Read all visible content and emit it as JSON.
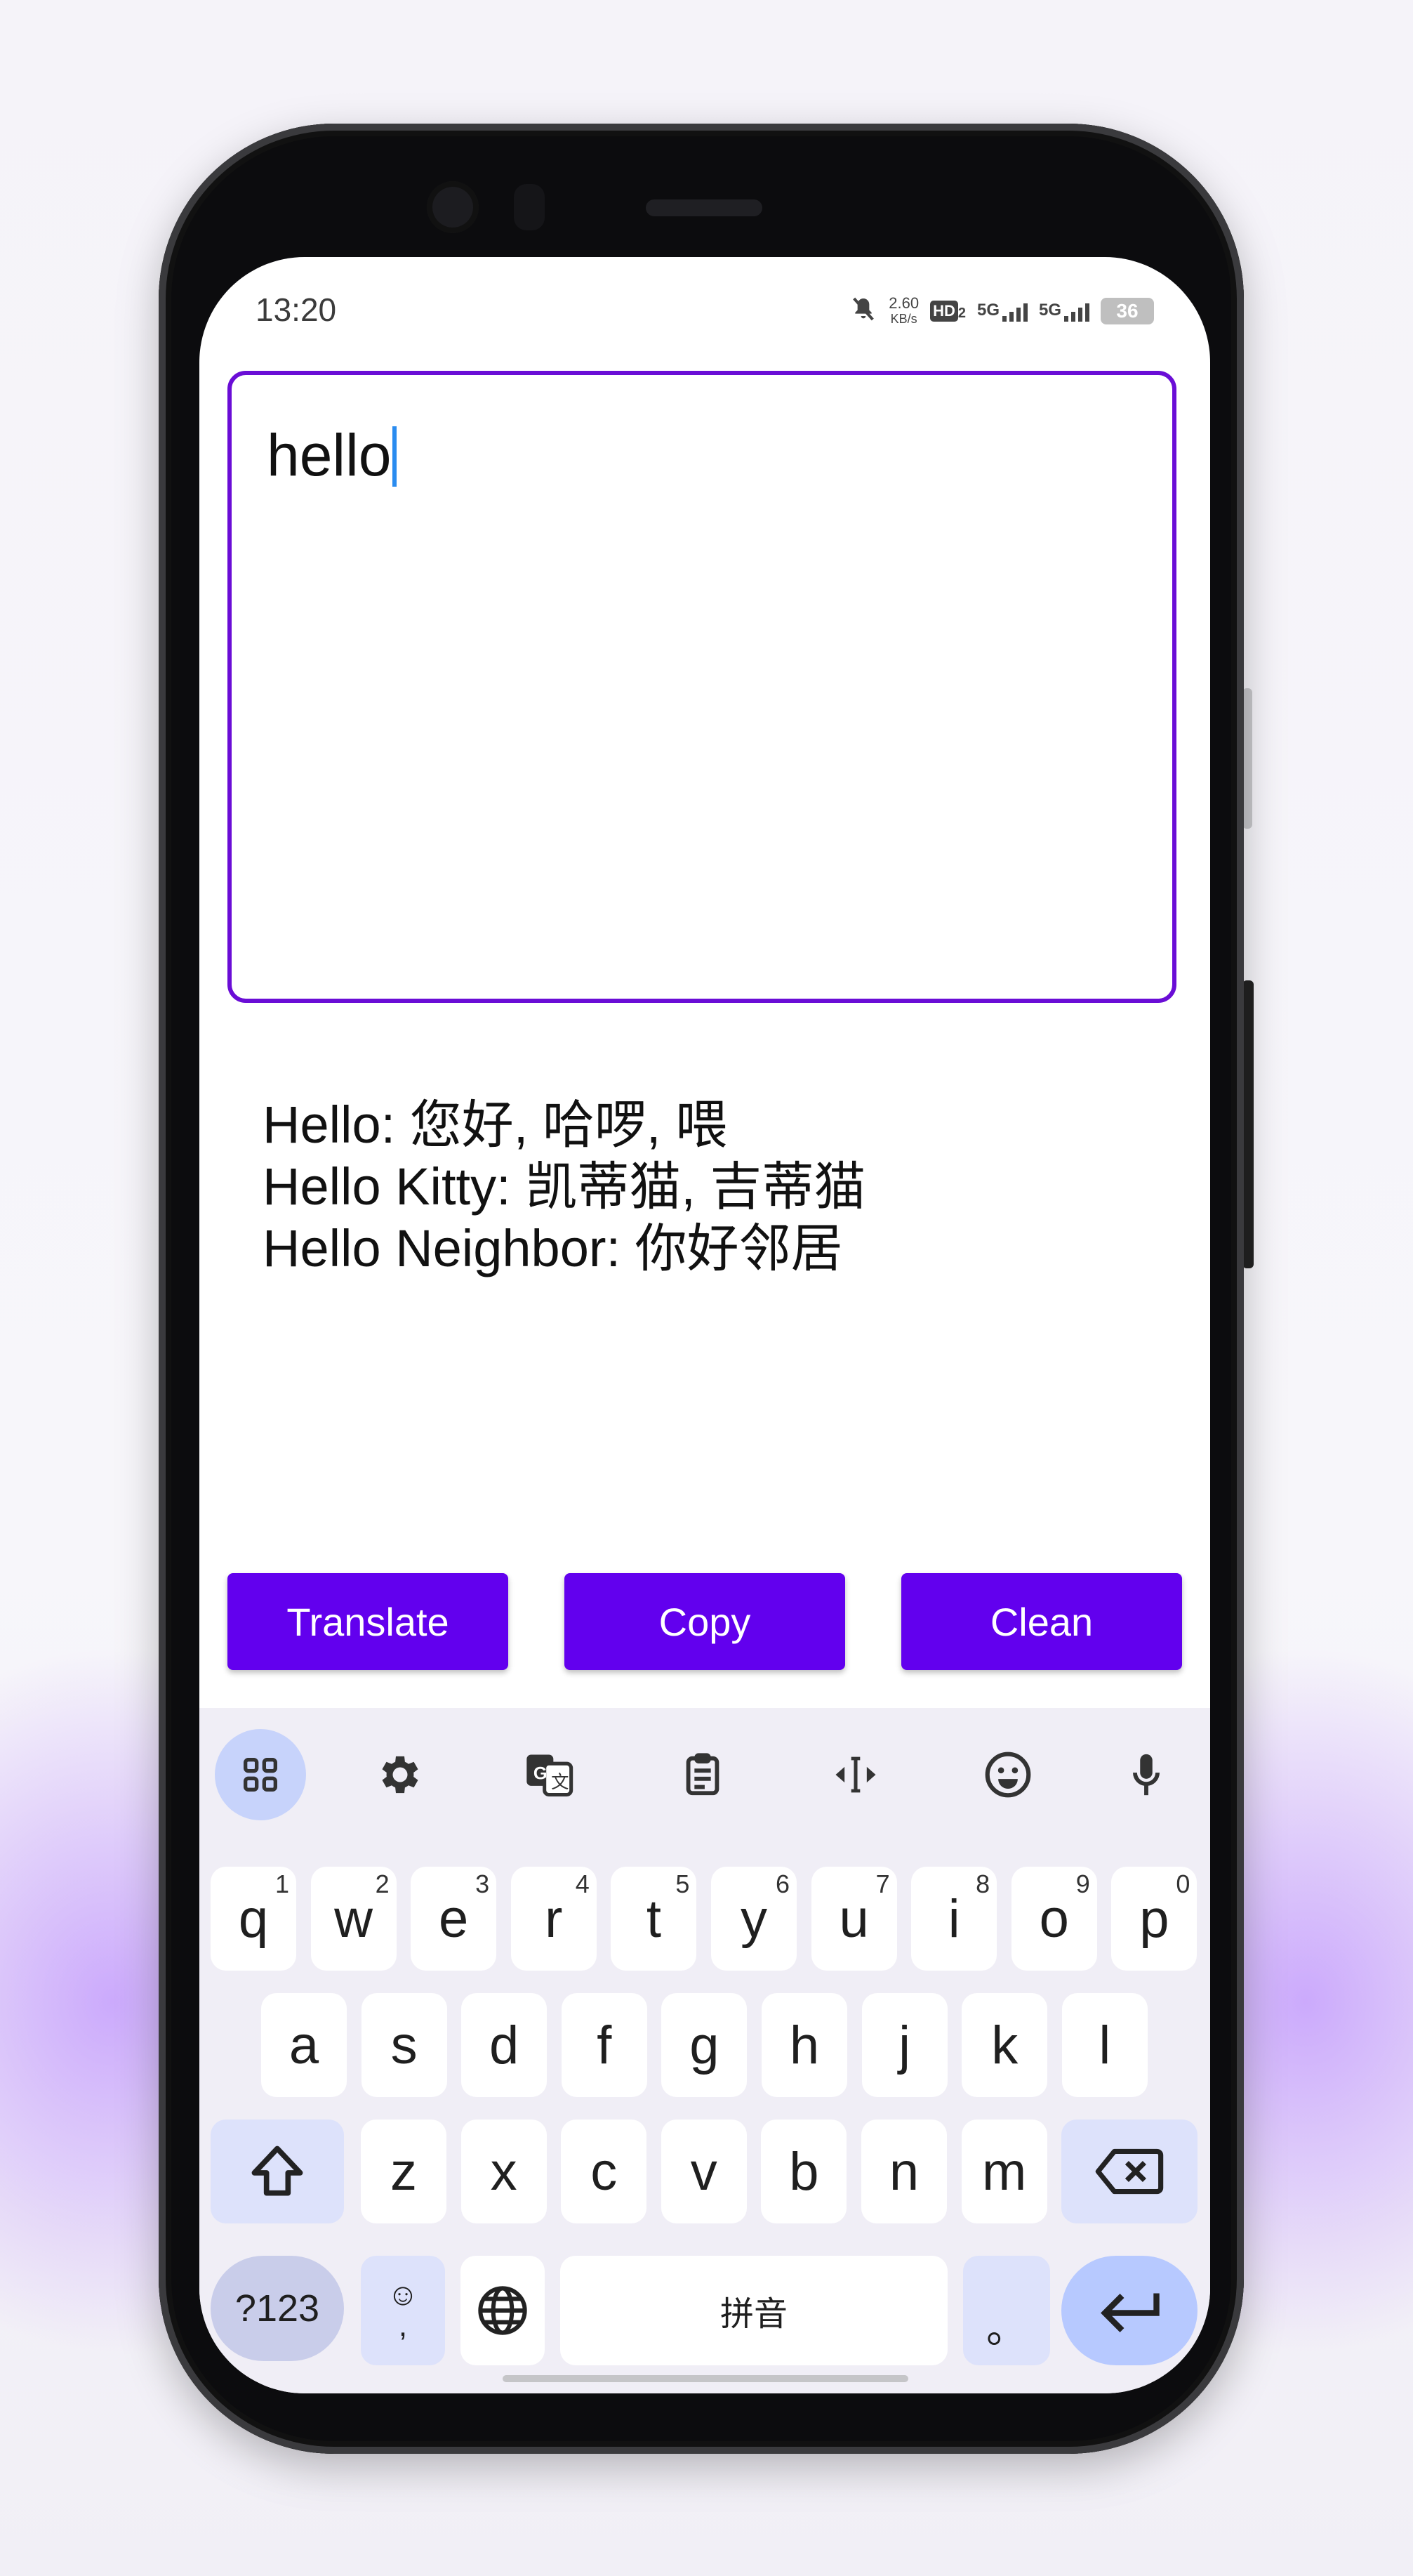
{
  "status_bar": {
    "time": "13:20",
    "network_speed": "2.60",
    "network_unit": "KB/s",
    "hd_label": "HD",
    "hd_sub": "2",
    "sim1": "5G",
    "sim2": "5G",
    "battery": "36"
  },
  "input": {
    "value": "hello"
  },
  "results": {
    "lines": [
      "Hello: 您好, 哈啰, 喂",
      "Hello Kitty: 凯蒂猫, 吉蒂猫",
      "Hello Neighbor: 你好邻居"
    ]
  },
  "buttons": {
    "translate": "Translate",
    "copy": "Copy",
    "clean": "Clean"
  },
  "keyboard": {
    "toolbar_icons": [
      "apps-grid-icon",
      "gear-icon",
      "translate-icon",
      "clipboard-icon",
      "text-cursor-icon",
      "emoji-icon",
      "microphone-icon"
    ],
    "row1": [
      {
        "k": "q",
        "h": "1"
      },
      {
        "k": "w",
        "h": "2"
      },
      {
        "k": "e",
        "h": "3"
      },
      {
        "k": "r",
        "h": "4"
      },
      {
        "k": "t",
        "h": "5"
      },
      {
        "k": "y",
        "h": "6"
      },
      {
        "k": "u",
        "h": "7"
      },
      {
        "k": "i",
        "h": "8"
      },
      {
        "k": "o",
        "h": "9"
      },
      {
        "k": "p",
        "h": "0"
      }
    ],
    "row2": [
      "a",
      "s",
      "d",
      "f",
      "g",
      "h",
      "j",
      "k",
      "l"
    ],
    "row3": [
      "z",
      "x",
      "c",
      "v",
      "b",
      "n",
      "m"
    ],
    "symbols": "?123",
    "emoji_top": "☺",
    "comma": ",",
    "space": "拼音",
    "period": "。"
  },
  "colors": {
    "accent": "#6200ee",
    "input_border": "#6a0dd6",
    "caret": "#2a8cf0"
  }
}
